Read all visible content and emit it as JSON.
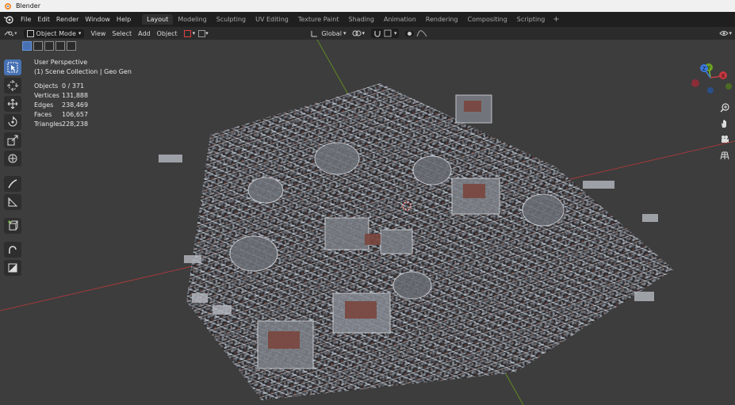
{
  "window": {
    "title": "Blender"
  },
  "menubar": {
    "items": [
      "File",
      "Edit",
      "Render",
      "Window",
      "Help"
    ],
    "workspaces": [
      "Layout",
      "Modeling",
      "Sculpting",
      "UV Editing",
      "Texture Paint",
      "Shading",
      "Animation",
      "Rendering",
      "Compositing",
      "Scripting"
    ],
    "active_workspace": "Layout",
    "add_tab": "+"
  },
  "header": {
    "mode": "Object Mode",
    "menus": [
      "View",
      "Select",
      "Add",
      "Object"
    ],
    "orientation": "Global"
  },
  "overlay": {
    "view_name": "User Perspective",
    "collection": "(1) Scene Collection | Geo Gen"
  },
  "stats": [
    {
      "label": "Objects",
      "value": "0 / 371"
    },
    {
      "label": "Vertices",
      "value": "131,888"
    },
    {
      "label": "Edges",
      "value": "238,469"
    },
    {
      "label": "Faces",
      "value": "106,657"
    },
    {
      "label": "Triangles",
      "value": "228,238"
    }
  ],
  "gizmo": {
    "x": "X",
    "y": "Y",
    "z": "Z"
  },
  "colors": {
    "x_axis": "#c14040",
    "y_axis": "#7ab52d",
    "z_axis": "#3f7fe0",
    "accent": "#4772b3"
  }
}
